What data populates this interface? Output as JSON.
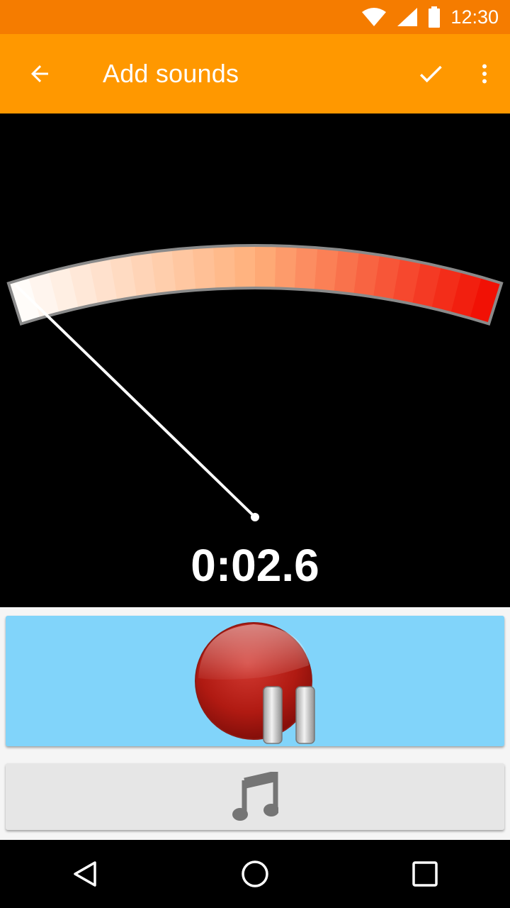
{
  "status_bar": {
    "time": "12:30",
    "icons": [
      "wifi-icon",
      "cellular-signal-icon",
      "battery-icon"
    ]
  },
  "app_bar": {
    "title": "Add sounds",
    "back_icon": "arrow-back-icon",
    "confirm_icon": "checkmark-icon",
    "menu_icon": "more-vert-icon",
    "background_color": "#FF9800",
    "status_color": "#F57C00"
  },
  "meter": {
    "timer": "0:02.6",
    "level": 0.0,
    "scale_start_color": "#FFFFFF",
    "scale_end_color": "#F00A00"
  },
  "controls": {
    "record_button_icon": "record-pause-icon",
    "record_button_color": "#81D4FA",
    "music_button_icon": "music-note-icon"
  },
  "nav_bar": {
    "icons": [
      "nav-back-icon",
      "nav-home-icon",
      "nav-recents-icon"
    ]
  }
}
